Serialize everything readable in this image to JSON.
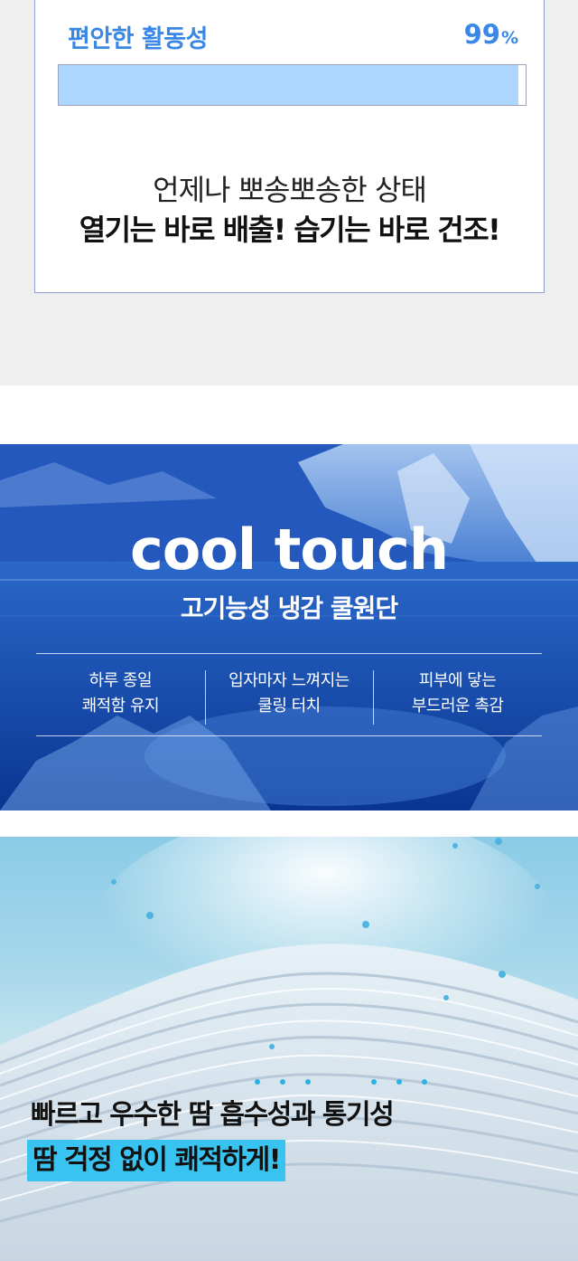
{
  "activity": {
    "title": "편안한 활동성",
    "percent_value": "99",
    "percent_unit": "%",
    "progress": 0.985,
    "line1": "언제나 뽀송뽀송한 상태",
    "line2": "열기는 바로 배출! 습기는 바로 건조!"
  },
  "cool": {
    "title": "cool touch",
    "subtitle": "고기능성 냉감 쿨원단",
    "features": [
      {
        "line1": "하루 종일",
        "line2": "쾌적함 유지"
      },
      {
        "line1": "입자마자 느껴지는",
        "line2": "쿨링 터치"
      },
      {
        "line1": "피부에 닿는",
        "line2": "부드러운 촉감"
      }
    ]
  },
  "sweat": {
    "line1": "빠르고 우수한 땀 흡수성과 통기성",
    "line2": "땀 걱정 없이 쾌적하게!"
  },
  "colors": {
    "accent_blue": "#3a88e6",
    "progress_fill": "#acd6ff",
    "highlight_cyan": "#38c3f1"
  }
}
